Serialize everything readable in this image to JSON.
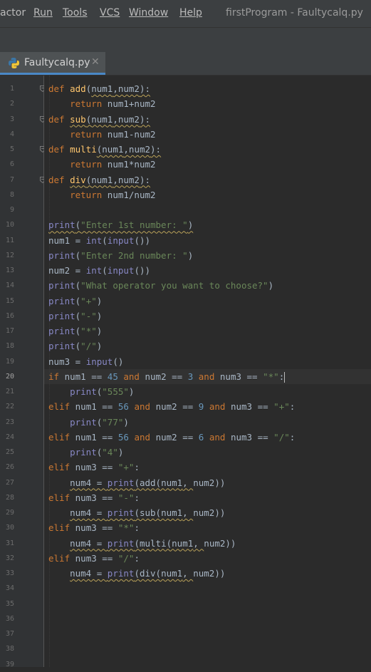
{
  "menubar": {
    "items": [
      "actor",
      "Run",
      "Tools",
      "VCS",
      "Window",
      "Help"
    ],
    "window_title": "firstProgram - Faultycalq.py"
  },
  "tab": {
    "label": "Faultycalq.py",
    "close": "✕",
    "icon": "python-file-icon"
  },
  "editor": {
    "current_line": 20,
    "line_numbers": [
      1,
      2,
      3,
      4,
      5,
      6,
      7,
      8,
      9,
      10,
      11,
      12,
      13,
      14,
      15,
      16,
      17,
      18,
      19,
      20,
      21,
      22,
      23,
      24,
      25,
      26,
      27,
      28,
      29,
      30,
      31,
      32,
      33,
      34,
      35,
      36,
      37,
      38,
      39
    ],
    "lines": [
      [
        [
          "kw",
          "def "
        ],
        [
          "fn",
          "add"
        ],
        [
          "",
          "("
        ],
        [
          "",
          "num1"
        ],
        [
          "",
          ","
        ],
        [
          "",
          "num2"
        ],
        [
          "",
          "):"
        ]
      ],
      [
        [
          "",
          "    "
        ],
        [
          "kw",
          "return "
        ],
        [
          "",
          "num1+num2"
        ]
      ],
      [
        [
          "kw",
          "def "
        ],
        [
          "fn",
          "sub"
        ],
        [
          "",
          "("
        ],
        [
          "",
          "num1"
        ],
        [
          "",
          ","
        ],
        [
          "",
          "num2"
        ],
        [
          "",
          "):"
        ]
      ],
      [
        [
          "",
          "    "
        ],
        [
          "kw",
          "return "
        ],
        [
          "",
          "num1-num2"
        ]
      ],
      [
        [
          "kw",
          "def "
        ],
        [
          "fn",
          "multi"
        ],
        [
          "",
          "("
        ],
        [
          "",
          "num1"
        ],
        [
          "",
          ","
        ],
        [
          "",
          "num2"
        ],
        [
          "",
          "):"
        ]
      ],
      [
        [
          "",
          "    "
        ],
        [
          "kw",
          "return "
        ],
        [
          "",
          "num1*num2"
        ]
      ],
      [
        [
          "kw",
          "def "
        ],
        [
          "fn",
          "div"
        ],
        [
          "",
          "("
        ],
        [
          "",
          "num1"
        ],
        [
          "",
          ","
        ],
        [
          "",
          "num2"
        ],
        [
          "",
          "):"
        ]
      ],
      [
        [
          "",
          "    "
        ],
        [
          "kw",
          "return "
        ],
        [
          "",
          "num1/num2"
        ]
      ],
      [],
      [
        [
          "bi",
          "print"
        ],
        [
          "",
          "("
        ],
        [
          "str",
          "\"Enter 1st number: \""
        ],
        [
          "",
          ")"
        ]
      ],
      [
        [
          "",
          "num1 = "
        ],
        [
          "bi",
          "int"
        ],
        [
          "",
          "("
        ],
        [
          "bi",
          "input"
        ],
        [
          "",
          "())"
        ]
      ],
      [
        [
          "bi",
          "print"
        ],
        [
          "",
          "("
        ],
        [
          "str",
          "\"Enter 2nd number: \""
        ],
        [
          "",
          ")"
        ]
      ],
      [
        [
          "",
          "num2 = "
        ],
        [
          "bi",
          "int"
        ],
        [
          "",
          "("
        ],
        [
          "bi",
          "input"
        ],
        [
          "",
          "())"
        ]
      ],
      [
        [
          "bi",
          "print"
        ],
        [
          "",
          "("
        ],
        [
          "str",
          "\"What operator you want to choose?\""
        ],
        [
          "",
          ")"
        ]
      ],
      [
        [
          "bi",
          "print"
        ],
        [
          "",
          "("
        ],
        [
          "str",
          "\"+\""
        ],
        [
          "",
          ")"
        ]
      ],
      [
        [
          "bi",
          "print"
        ],
        [
          "",
          "("
        ],
        [
          "str",
          "\"-\""
        ],
        [
          "",
          ")"
        ]
      ],
      [
        [
          "bi",
          "print"
        ],
        [
          "",
          "("
        ],
        [
          "str",
          "\"*\""
        ],
        [
          "",
          ")"
        ]
      ],
      [
        [
          "bi",
          "print"
        ],
        [
          "",
          "("
        ],
        [
          "str",
          "\"/\""
        ],
        [
          "",
          ")"
        ]
      ],
      [
        [
          "",
          "num3 = "
        ],
        [
          "bi",
          "input"
        ],
        [
          "",
          "()"
        ]
      ],
      [
        [
          "kw",
          "if "
        ],
        [
          "",
          "num1 == "
        ],
        [
          "num",
          "45"
        ],
        [
          "kw",
          " and "
        ],
        [
          "",
          "num2 == "
        ],
        [
          "num",
          "3"
        ],
        [
          "kw",
          " and "
        ],
        [
          "",
          "num3 == "
        ],
        [
          "str",
          "\"*\""
        ],
        [
          "",
          ":"
        ]
      ],
      [
        [
          "",
          "    "
        ],
        [
          "bi",
          "print"
        ],
        [
          "",
          "("
        ],
        [
          "str",
          "\"555\""
        ],
        [
          "",
          ")"
        ]
      ],
      [
        [
          "kw",
          "elif "
        ],
        [
          "",
          "num1 == "
        ],
        [
          "num",
          "56"
        ],
        [
          "kw",
          " and "
        ],
        [
          "",
          "num2 == "
        ],
        [
          "num",
          "9"
        ],
        [
          "kw",
          " and "
        ],
        [
          "",
          "num3 == "
        ],
        [
          "str",
          "\"+\""
        ],
        [
          "",
          ":"
        ]
      ],
      [
        [
          "",
          "    "
        ],
        [
          "bi",
          "print"
        ],
        [
          "",
          "("
        ],
        [
          "str",
          "\"77\""
        ],
        [
          "",
          ")"
        ]
      ],
      [
        [
          "kw",
          "elif "
        ],
        [
          "",
          "num1 == "
        ],
        [
          "num",
          "56"
        ],
        [
          "kw",
          " and "
        ],
        [
          "",
          "num2 == "
        ],
        [
          "num",
          "6"
        ],
        [
          "kw",
          " and "
        ],
        [
          "",
          "num3 == "
        ],
        [
          "str",
          "\"/\""
        ],
        [
          "",
          ":"
        ]
      ],
      [
        [
          "",
          "    "
        ],
        [
          "bi",
          "print"
        ],
        [
          "",
          "("
        ],
        [
          "str",
          "\"4\""
        ],
        [
          "",
          ")"
        ]
      ],
      [
        [
          "kw",
          "elif "
        ],
        [
          "",
          "num3 == "
        ],
        [
          "str",
          "\"+\""
        ],
        [
          "",
          ":"
        ]
      ],
      [
        [
          "",
          "    "
        ],
        [
          "",
          "num4 = "
        ],
        [
          "bi",
          "print"
        ],
        [
          "",
          "(add(num1"
        ],
        [
          "",
          ", "
        ],
        [
          "",
          "num2))"
        ]
      ],
      [
        [
          "kw",
          "elif "
        ],
        [
          "",
          "num3 == "
        ],
        [
          "str",
          "\"-\""
        ],
        [
          "",
          ":"
        ]
      ],
      [
        [
          "",
          "    "
        ],
        [
          "",
          "num4 = "
        ],
        [
          "bi",
          "print"
        ],
        [
          "",
          "(sub(num1"
        ],
        [
          "",
          ", "
        ],
        [
          "",
          "num2))"
        ]
      ],
      [
        [
          "kw",
          "elif "
        ],
        [
          "",
          "num3 == "
        ],
        [
          "str",
          "\"*\""
        ],
        [
          "",
          ":"
        ]
      ],
      [
        [
          "",
          "    "
        ],
        [
          "",
          "num4 = "
        ],
        [
          "bi",
          "print"
        ],
        [
          "",
          "(multi(num1"
        ],
        [
          "",
          ", "
        ],
        [
          "",
          "num2))"
        ]
      ],
      [
        [
          "kw",
          "elif "
        ],
        [
          "",
          "num3 == "
        ],
        [
          "str",
          "\"/\""
        ],
        [
          "",
          ":"
        ]
      ],
      [
        [
          "",
          "    "
        ],
        [
          "",
          "num4 = "
        ],
        [
          "bi",
          "print"
        ],
        [
          "",
          "(div(num1"
        ],
        [
          "",
          ", "
        ],
        [
          "",
          "num2))"
        ]
      ],
      [],
      [],
      [],
      [],
      [],
      []
    ]
  },
  "colors": {
    "keyword": "#cc7832",
    "function": "#ffc66d",
    "builtin": "#8888c6",
    "string": "#6a8759",
    "number": "#6897bb",
    "text": "#a9b7c6",
    "background": "#2b2b2b",
    "gutter": "#313335",
    "chrome": "#3c3f41"
  }
}
